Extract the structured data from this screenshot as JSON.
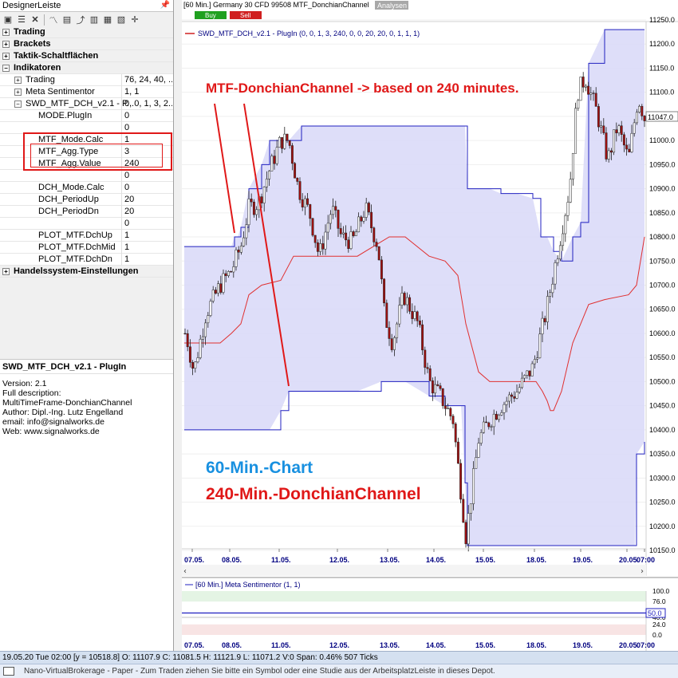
{
  "left_panel": {
    "title": "DesignerLeiste",
    "pin_icon": "pin-icon",
    "toolbar_icons": [
      "new-icon",
      "list-icon",
      "delete-icon",
      "indicator-icon",
      "chart-icon",
      "compare-icon",
      "bars-icon",
      "grid-icon",
      "table-icon",
      "crosshair-icon"
    ]
  },
  "properties": [
    {
      "label": "Trading",
      "value": "",
      "level": 0,
      "expander": "+",
      "kind": "cat"
    },
    {
      "label": "Brackets",
      "value": "",
      "level": 0,
      "expander": "+",
      "kind": "cat"
    },
    {
      "label": "Taktik-Schaltflächen",
      "value": "",
      "level": 0,
      "expander": "+",
      "kind": "cat"
    },
    {
      "label": "Indikatoren",
      "value": "",
      "level": 0,
      "expander": "-",
      "kind": "cat"
    },
    {
      "label": "Trading",
      "value": "76, 24, 40, ...",
      "level": 1,
      "expander": "+",
      "kind": "item"
    },
    {
      "label": "Meta Sentimentor",
      "value": "1, 1",
      "level": 1,
      "expander": "+",
      "kind": "item"
    },
    {
      "label": "SWD_MTF_DCH_v2.1 - P...",
      "value": "0, 0, 1, 3, 2...",
      "level": 1,
      "expander": "-",
      "kind": "item"
    },
    {
      "label": "MODE.PlugIn",
      "value": "0",
      "level": 2,
      "expander": "",
      "kind": "item"
    },
    {
      "label": "",
      "value": "0",
      "level": 2,
      "expander": "",
      "kind": "item"
    },
    {
      "label": "MTF_Mode.Calc",
      "value": "1",
      "level": 2,
      "expander": "",
      "kind": "item"
    },
    {
      "label": "MTF_Agg.Type",
      "value": "3",
      "level": 2,
      "expander": "",
      "kind": "item"
    },
    {
      "label": "MTF_Agg.Value",
      "value": "240",
      "level": 2,
      "expander": "",
      "kind": "item"
    },
    {
      "label": "",
      "value": "0",
      "level": 2,
      "expander": "",
      "kind": "item"
    },
    {
      "label": "DCH_Mode.Calc",
      "value": "0",
      "level": 2,
      "expander": "",
      "kind": "item"
    },
    {
      "label": "DCH_PeriodUp",
      "value": "20",
      "level": 2,
      "expander": "",
      "kind": "item"
    },
    {
      "label": "DCH_PeriodDn",
      "value": "20",
      "level": 2,
      "expander": "",
      "kind": "item"
    },
    {
      "label": "",
      "value": "0",
      "level": 2,
      "expander": "",
      "kind": "item"
    },
    {
      "label": "PLOT_MTF.DchUp",
      "value": "1",
      "level": 2,
      "expander": "",
      "kind": "item"
    },
    {
      "label": "PLOT_MTF.DchMid",
      "value": "1",
      "level": 2,
      "expander": "",
      "kind": "item"
    },
    {
      "label": "PLOT_MTF.DchDn",
      "value": "1",
      "level": 2,
      "expander": "",
      "kind": "item"
    },
    {
      "label": "Handelssystem-Einstellungen",
      "value": "",
      "level": 0,
      "expander": "+",
      "kind": "cat"
    }
  ],
  "description": {
    "title": "SWD_MTF_DCH_v2.1 - PlugIn",
    "lines": [
      "Version: 2.1",
      "Full description:",
      "MultiTimeFrame-DonchianChannel",
      "Author: Dipl.-Ing. Lutz Engelland",
      "email: info@signalworks.de",
      "Web: www.signalworks.de"
    ]
  },
  "chart": {
    "title": "[60 Min.] Germany 30 CFD   99508 MTF_DonchianChannel",
    "analysen_button": "Analysen",
    "buy_button": "Buy",
    "sell_button": "Sell",
    "legend": "SWD_MTF_DCH_v2.1 - PlugIn  (0, 0, 1, 3, 240, 0, 0, 20, 20, 0, 1, 1, 1)",
    "annotation_main": "MTF-DonchianChannel -> based on 240 minutes.",
    "annotation_chart": "60-Min.-Chart",
    "annotation_dch": "240-Min.-DonchianChannel",
    "last_price": "11047.0",
    "x_ticks": [
      "07.05.",
      "08.05.",
      "11.05.",
      "12.05.",
      "13.05.",
      "14.05.",
      "15.05.",
      "18.05.",
      "19.05.",
      "20.05.",
      "07:00"
    ],
    "y_ticks": [
      "11250.0",
      "11200.0",
      "11150.0",
      "11100.0",
      "11050.0",
      "11000.0",
      "10950.0",
      "10900.0",
      "10850.0",
      "10800.0",
      "10750.0",
      "10700.0",
      "10650.0",
      "10600.0",
      "10550.0",
      "10500.0",
      "10450.0",
      "10400.0",
      "10350.0",
      "10300.0",
      "10250.0",
      "10200.0",
      "10150.0"
    ]
  },
  "sub_chart": {
    "legend": "[60 Min.] Meta Sentimentor  (1, 1)",
    "y_ticks": [
      "100.0",
      "76.0",
      "50.0",
      "40.0",
      "24.0",
      "0.0"
    ],
    "current_value": "50.0"
  },
  "status_bar": "19.05.20 Tue  02:00 [y = 10518.8]          O: 11107.9 C: 11081.5 H: 11121.9 L: 11071.2 V:0 Span: 0.46% 507 Ticks",
  "bottom_bar": "Nano-VirtualBrokerage - Paper - Zum Traden ziehen Sie bitte ein Symbol oder eine Studie aus der ArbeitsplatzLeiste in dieses Depot.",
  "colors": {
    "channel_fill": "#d8d8f8",
    "channel_line": "#2020c0",
    "mid_line": "#e03030",
    "annotation_red": "#e01818",
    "annotation_blue": "#1890e0",
    "candle_up": "#ffffff",
    "candle_down": "#a01010"
  }
}
